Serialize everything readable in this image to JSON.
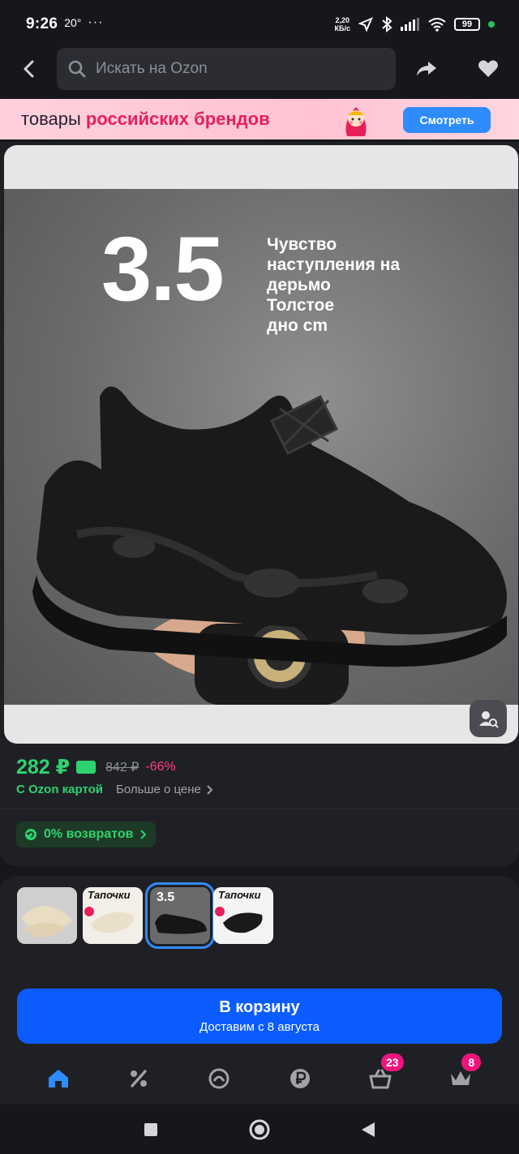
{
  "status": {
    "time": "9:26",
    "temp": "20°",
    "dots": "···",
    "speed_value": "2,20",
    "speed_unit": "КБ/с",
    "battery": "99"
  },
  "search": {
    "placeholder": "Искать на Ozon"
  },
  "banner": {
    "text_plain": "товары ",
    "text_bold": "российских брендов",
    "button": "Смотреть"
  },
  "product": {
    "image_headline_number": "3.5",
    "image_slogan": "Чувство\nнаступления на\nдерьмо\nТолстое\nдно cm",
    "price": "282 ₽",
    "old_price": "842 ₽",
    "discount": "-66%",
    "ozon_card_label": "С Ozon картой",
    "more_price_label": "Больше о цене",
    "returns_label": "0% возвратов"
  },
  "variants": [
    {
      "label": "",
      "type": "beige-clog"
    },
    {
      "label": "Тапочки",
      "type": "beige-slipper"
    },
    {
      "label": "3.5",
      "type": "black-sneaker",
      "selected": true
    },
    {
      "label": "Тапочки",
      "type": "black-slipper"
    }
  ],
  "cart": {
    "title": "В корзину",
    "delivery": "Доставим с 8 августа"
  },
  "nav": {
    "items": [
      "home-icon",
      "percent-icon",
      "brand-icon",
      "ruble-icon",
      "basket-icon",
      "crown-icon"
    ],
    "cart_badge": "23",
    "favorites_badge": "8"
  },
  "colors": {
    "accent": "#0b5cff",
    "price": "#2dd36f",
    "discount": "#ff3d7f",
    "badge": "#f0157d"
  }
}
